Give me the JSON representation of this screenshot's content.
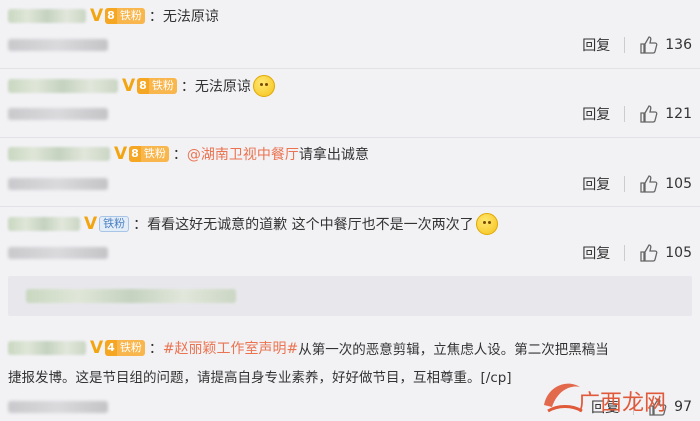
{
  "comments": [
    {
      "fan_label": "铁粉",
      "fan_level": "8",
      "text": "：无法原谅",
      "reply": "回复",
      "likes": "136"
    },
    {
      "fan_label": "铁粉",
      "fan_level": "8",
      "text": "：无法原谅",
      "reply": "回复",
      "likes": "121"
    },
    {
      "fan_label": "铁粉",
      "fan_level": "8",
      "prefix": "：",
      "mention": "@湖南卫视中餐厅",
      "text": " 请拿出诚意",
      "reply": "回复",
      "likes": "105"
    },
    {
      "fan_label": "铁粉",
      "text": "：看看这好无诚意的道歉 这个中餐厅也不是一次两次了",
      "reply": "回复",
      "likes": "105"
    },
    {
      "fan_label": "铁粉",
      "fan_level": "4",
      "prefix": "：",
      "topic": "#赵丽颖工作室声明#",
      "text_line1": " 从第一次的恶意剪辑，立焦虑人设。第二次把黑稿当",
      "text_line2": "捷报发博。这是节目组的问题，请提高自身专业素养，好好做节目，互相尊重。[/cp]",
      "reply": "回复",
      "likes": "97"
    }
  ],
  "watermark": "广西龙网",
  "colors": {
    "accent": "#eb7350",
    "vip": "#f2a511"
  },
  "icons": {
    "like": "thumbs-up-icon",
    "verified": "vip-v-icon",
    "emoji": "smile-emoji-icon"
  }
}
